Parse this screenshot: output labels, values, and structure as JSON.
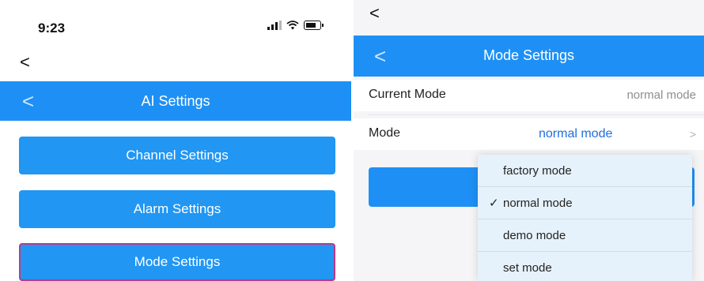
{
  "left_screen": {
    "status_time": "9:23",
    "back_glyph": "<",
    "header": {
      "back_glyph": "<",
      "title": "AI Settings"
    },
    "buttons": [
      {
        "label": "Channel Settings"
      },
      {
        "label": "Alarm Settings"
      },
      {
        "label": "Mode Settings"
      }
    ]
  },
  "right_screen": {
    "back_glyph": "<",
    "header": {
      "back_glyph": "<",
      "title": "Mode Settings"
    },
    "current_mode": {
      "label": "Current Mode",
      "value": "normal mode"
    },
    "mode": {
      "label": "Mode",
      "value": "normal mode",
      "chevron": ">"
    },
    "dropdown": {
      "check_glyph": "✓",
      "selected": "normal mode",
      "options": [
        "factory mode",
        "normal mode",
        "demo mode",
        "set mode"
      ]
    }
  },
  "colors": {
    "accent_blue": "#1e90f5",
    "button_blue": "#2196f3",
    "active_border": "#b83a8a"
  },
  "icons": [
    "signal-icon",
    "wifi-icon",
    "battery-icon",
    "back-icon",
    "chevron-right-icon",
    "check-icon"
  ]
}
